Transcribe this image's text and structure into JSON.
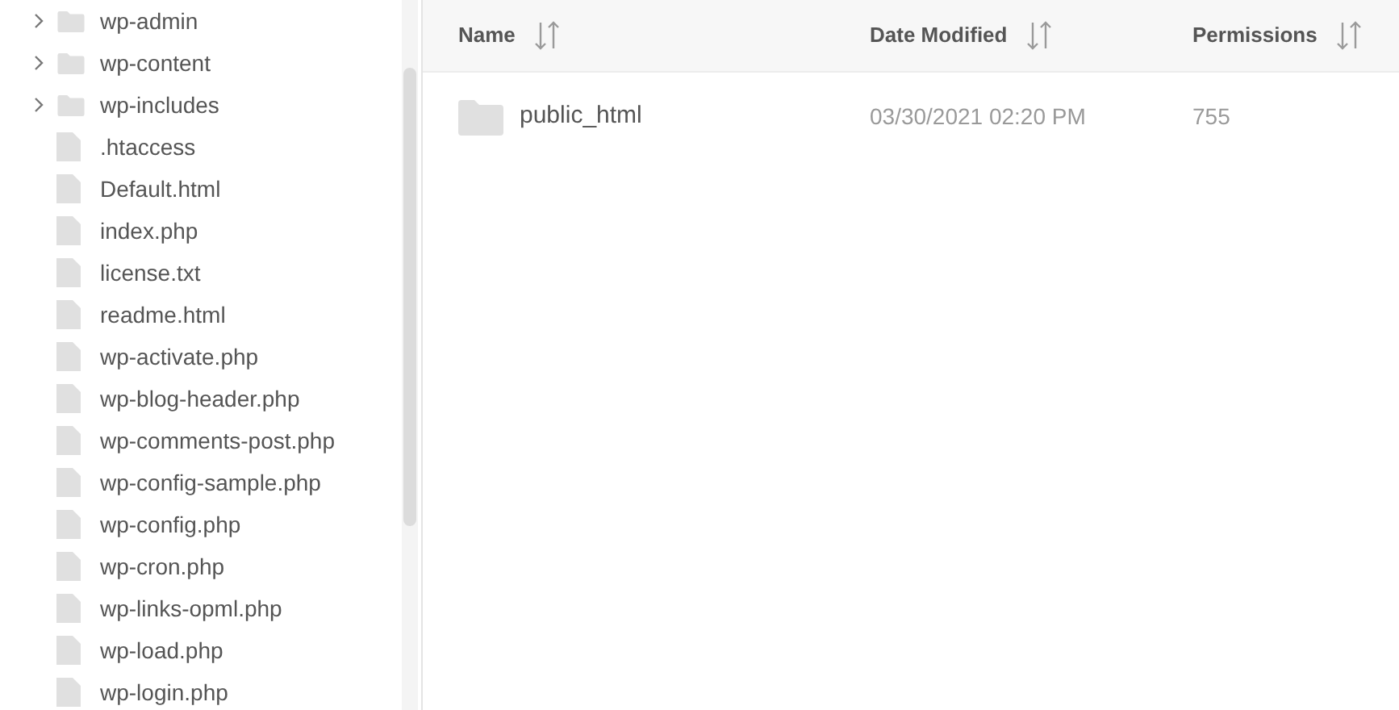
{
  "tree": [
    {
      "kind": "folder",
      "name": "wp-admin",
      "expanded": false
    },
    {
      "kind": "folder",
      "name": "wp-content",
      "expanded": false
    },
    {
      "kind": "folder",
      "name": "wp-includes",
      "expanded": false
    },
    {
      "kind": "file",
      "name": ".htaccess"
    },
    {
      "kind": "file",
      "name": "Default.html"
    },
    {
      "kind": "file",
      "name": "index.php"
    },
    {
      "kind": "file",
      "name": "license.txt"
    },
    {
      "kind": "file",
      "name": "readme.html"
    },
    {
      "kind": "file",
      "name": "wp-activate.php"
    },
    {
      "kind": "file",
      "name": "wp-blog-header.php"
    },
    {
      "kind": "file",
      "name": "wp-comments-post.php"
    },
    {
      "kind": "file",
      "name": "wp-config-sample.php"
    },
    {
      "kind": "file",
      "name": "wp-config.php"
    },
    {
      "kind": "file",
      "name": "wp-cron.php"
    },
    {
      "kind": "file",
      "name": "wp-links-opml.php"
    },
    {
      "kind": "file",
      "name": "wp-load.php"
    },
    {
      "kind": "file",
      "name": "wp-login.php"
    }
  ],
  "table": {
    "columns": [
      "Name",
      "Date Modified",
      "Permissions"
    ],
    "rows": [
      {
        "kind": "folder",
        "name": "public_html",
        "date_modified": "03/30/2021 02:20 PM",
        "permissions": "755"
      }
    ]
  }
}
